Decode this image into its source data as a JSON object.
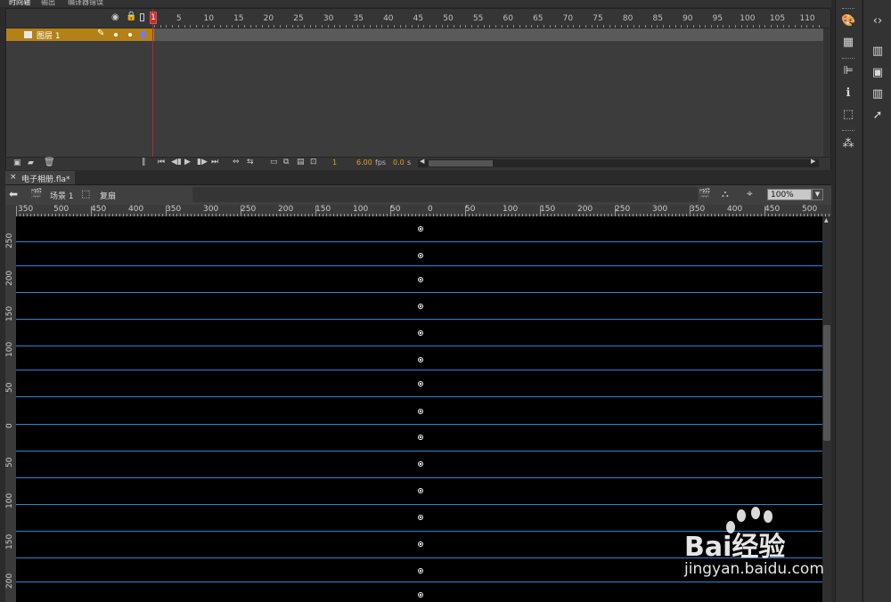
{
  "panel_tabs": [
    "时间轴",
    "输出",
    "编译器错误"
  ],
  "timeline": {
    "frame_numbers": [
      "1",
      "5",
      "10",
      "15",
      "20",
      "25",
      "30",
      "35",
      "40",
      "45",
      "50",
      "55",
      "60",
      "65",
      "70",
      "75",
      "80",
      "85",
      "90",
      "95",
      "100",
      "105",
      "110"
    ],
    "layer": {
      "name": "图层 1"
    },
    "current_frame": "1",
    "fps": "6.00",
    "fps_unit": "fps",
    "elapsed": "0.0",
    "elapsed_unit": "s"
  },
  "document": {
    "tab_label": "电子相册.fla*",
    "close_glyph": "×",
    "scene_label": "场景 1",
    "symbol_label": "复扇",
    "zoom": "100%"
  },
  "stage": {
    "hruler_labels": [
      "350",
      "500",
      "450",
      "400",
      "350",
      "300",
      "250",
      "200",
      "150",
      "100",
      "50",
      "0",
      "50",
      "100",
      "150",
      "200",
      "250",
      "300",
      "350",
      "400",
      "450",
      "500"
    ],
    "vruler_labels": [
      "250",
      "200",
      "150",
      "100",
      "50",
      "0",
      "50",
      "100",
      "150",
      "200"
    ],
    "background_color": "#000000",
    "guide_color": "#2a86d6"
  },
  "watermark": {
    "text": "Bai经验",
    "url": "jingyan.baidu.com"
  },
  "colors": {
    "layer_row": "#b58116",
    "playhead": "#c03030"
  }
}
